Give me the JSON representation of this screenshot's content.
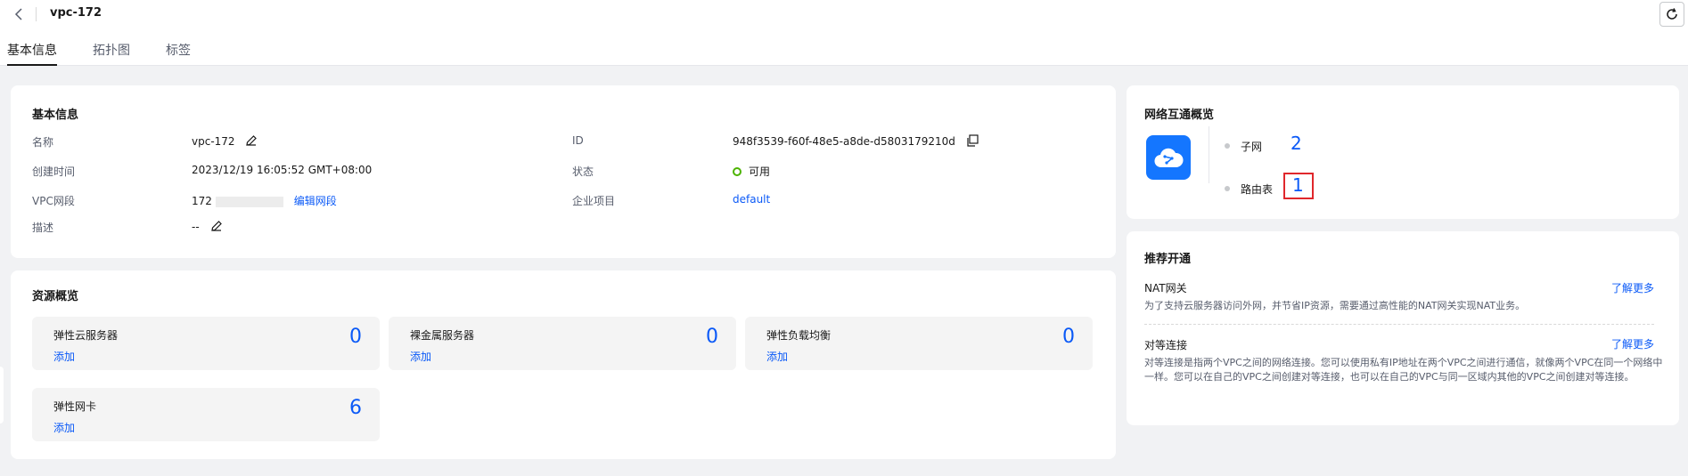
{
  "header": {
    "title": "vpc-172",
    "tabs": [
      "基本信息",
      "拓扑图",
      "标签"
    ]
  },
  "basic_info": {
    "title": "基本信息",
    "name_label": "名称",
    "name_value": "vpc-172",
    "created_label": "创建时间",
    "created_value": "2023/12/19 16:05:52 GMT+08:00",
    "cidr_label": "VPC网段",
    "cidr_value": "172",
    "cidr_edit": "编辑网段",
    "desc_label": "描述",
    "desc_value": "--",
    "id_label": "ID",
    "id_value": "948f3539-f60f-48e5-a8de-d5803179210d",
    "status_label": "状态",
    "status_value": "可用",
    "project_label": "企业项目",
    "project_value": "default"
  },
  "resources": {
    "title": "资源概览",
    "add_label": "添加",
    "items": [
      {
        "name": "弹性云服务器",
        "count": "0"
      },
      {
        "name": "裸金属服务器",
        "count": "0"
      },
      {
        "name": "弹性负载均衡",
        "count": "0"
      },
      {
        "name": "弹性网卡",
        "count": "6"
      }
    ]
  },
  "network": {
    "title": "网络互通概览",
    "subnet_label": "子网",
    "subnet_count": "2",
    "route_label": "路由表",
    "route_count": "1"
  },
  "recommend": {
    "title": "推荐开通",
    "learn_more": "了解更多",
    "items": [
      {
        "name": "NAT网关",
        "desc": "为了支持云服务器访问外网，并节省IP资源，需要通过高性能的NAT网关实现NAT业务。"
      },
      {
        "name": "对等连接",
        "desc": "对等连接是指两个VPC之间的网络连接。您可以使用私有IP地址在两个VPC之间进行通信，就像两个VPC在同一个网络中一样。您可以在自己的VPC之间创建对等连接，也可以在自己的VPC与同一区域内其他的VPC之间创建对等连接。"
      }
    ]
  },
  "colors": {
    "accent": "#0a59f7",
    "icon_bg": "#1476ff",
    "status_ok": "#4cb300",
    "highlight": "#e0272c"
  }
}
